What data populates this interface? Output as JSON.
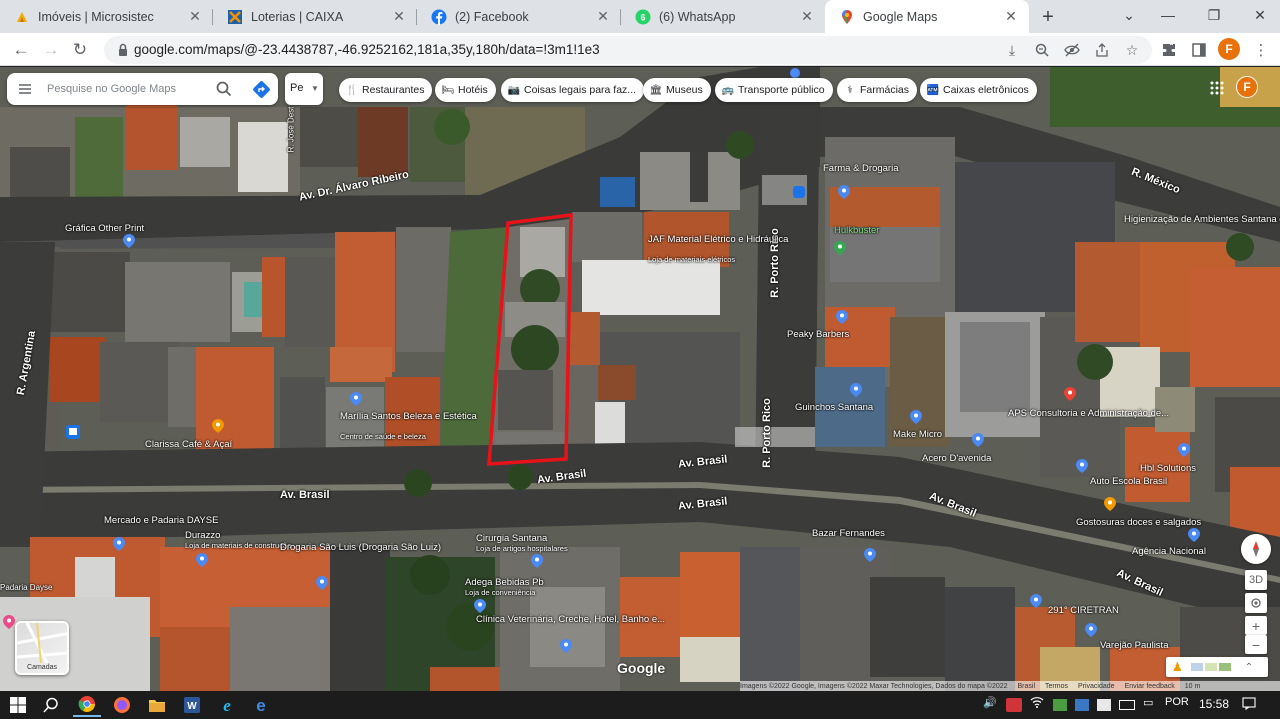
{
  "tabs": [
    {
      "title": "Imóveis | Microsistec",
      "icon": "microsistec-icon"
    },
    {
      "title": "Loterias | CAIXA",
      "icon": "caixa-icon"
    },
    {
      "title": "(2) Facebook",
      "icon": "facebook-icon"
    },
    {
      "title": "(6) WhatsApp",
      "icon": "whatsapp-icon"
    },
    {
      "title": "Google Maps",
      "icon": "google-maps-icon",
      "active": true
    }
  ],
  "address_bar": {
    "url": "google.com/maps/@-23.4438787,-46.9252162,181a,35y,180h/data=!3m1!1e3"
  },
  "profile_initial": "F",
  "search": {
    "placeholder": "Pesquise no Google Maps"
  },
  "layer_button": {
    "label": "Pе"
  },
  "chips": [
    {
      "label": "Restaurantes",
      "icon": "fork-knife-icon"
    },
    {
      "label": "Hotéis",
      "icon": "bed-icon"
    },
    {
      "label": "Coisas legais para faz...",
      "icon": "camera-icon"
    },
    {
      "label": "Museus",
      "icon": "museum-icon"
    },
    {
      "label": "Transporte público",
      "icon": "bus-icon"
    },
    {
      "label": "Farmácias",
      "icon": "pharmacy-icon"
    },
    {
      "label": "Caixas eletrônicos",
      "icon": "atm-icon"
    }
  ],
  "map_labels": {
    "streets": [
      "Av. Dr. Álvaro Ribeiro",
      "R. Argentina",
      "Av. Brasil",
      "Av. Brasil",
      "Av. Brasil",
      "Av. Brasil",
      "Av. Brasil",
      "Av. Brasil",
      "R. Porto Rico",
      "R. Porto Rico",
      "R. México",
      "R. José Dest"
    ],
    "places": [
      "Gráfica Other Print",
      "JAF Material Elétrico e Hidráulica",
      "Loja de materiais elétricos",
      "Farma & Drogaria",
      "Hulkbuster",
      "Higienização de Ambientes Santana de Parnaíba",
      "Peaky Barbers",
      "Guinchos Santana",
      "Marília Santos Beleza e Estética",
      "Centro de saúde e beleza",
      "Clarissa Café & Açaí",
      "Make Micro",
      "Acero D'avenida",
      "APS Consultoria e Administração de...",
      "Hbl Solutions",
      "Auto Escola Brasil",
      "Gostosuras doces e salgados",
      "Agência Nacional",
      "Mercado e Padaria DAYSE",
      "Durazzo",
      "Loja de materiais de construção",
      "Drogaria São Luis (Drogaria São Luiz)",
      "Cirurgia Santana",
      "Loja de artigos hospitalares",
      "Adega Bebidas Pb",
      "Loja de conveniência",
      "Clínica Veterinária, Creche, Hotel, Banho e...",
      "Bazar Fernandes",
      "291° CIRETRAN",
      "Varejão Paulista",
      "Padaria Dayse"
    ]
  },
  "map_controls": {
    "tilt_label": "3D",
    "zoom_in": "+",
    "zoom_out": "−",
    "layer_label": "Camadas"
  },
  "map_footer": {
    "attribution": "Imagens ©2022 Google, Imagens ©2022 Maxar Technologies, Dados do mapa ©2022",
    "links": [
      "Brasil",
      "Termos",
      "Privacidade",
      "Enviar feedback"
    ],
    "scale": "10 m",
    "logo": "Google"
  },
  "taskbar": {
    "apps": [
      "windows-start-icon",
      "search-icon",
      "chrome-icon",
      "firefox-icon",
      "file-explorer-icon",
      "word-icon",
      "internet-explorer-icon",
      "edge-icon"
    ],
    "language": "POR",
    "time": "15:58"
  },
  "colors": {
    "highlight": "#e8131a",
    "accent": "#1a73e8",
    "profile": "#e8710a"
  }
}
